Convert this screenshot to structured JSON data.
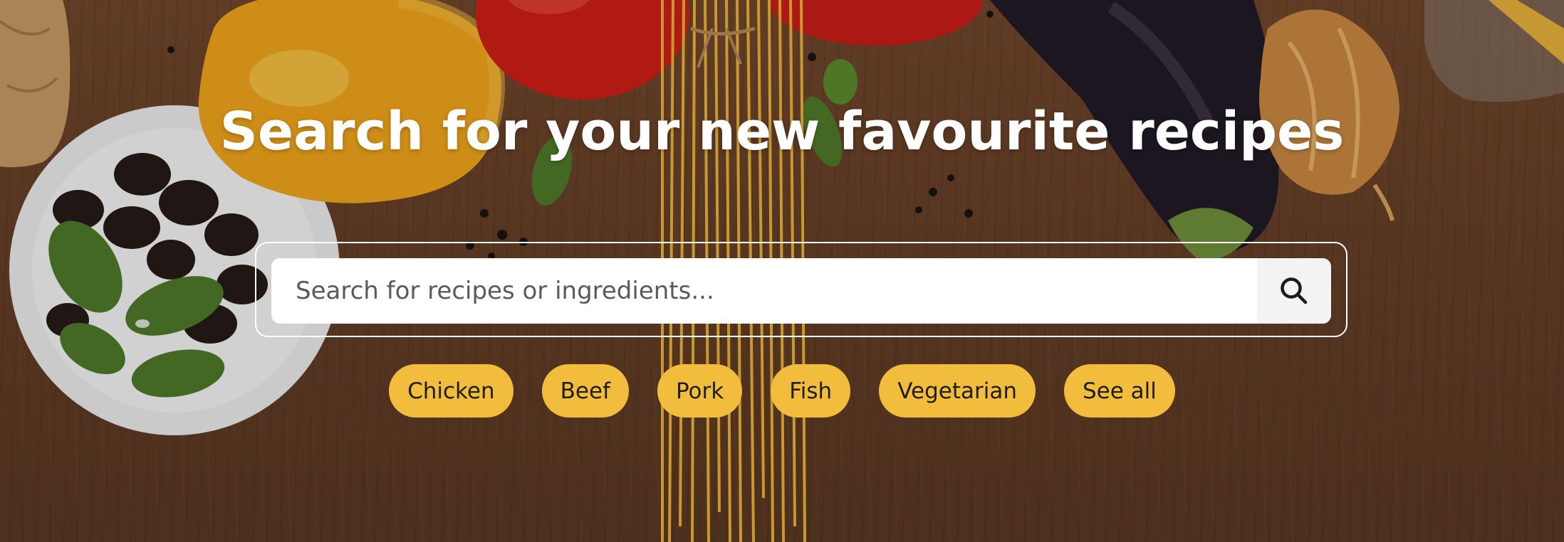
{
  "hero": {
    "heading": "Search for your new favourite recipes"
  },
  "search": {
    "placeholder": "Search for recipes or ingredients...",
    "icon": "search-icon"
  },
  "categories": [
    {
      "label": "Chicken"
    },
    {
      "label": "Beef"
    },
    {
      "label": "Pork"
    },
    {
      "label": "Fish"
    },
    {
      "label": "Vegetarian"
    },
    {
      "label": "See all"
    }
  ],
  "colors": {
    "chip_background": "#f2bd3c",
    "chip_text": "#1e1e1e",
    "heading": "#ffffff",
    "search_button_bg": "#f3f3f3",
    "background_wood": "#6a4228"
  }
}
